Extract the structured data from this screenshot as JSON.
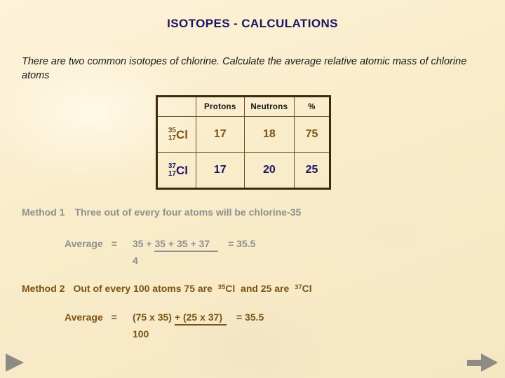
{
  "slide": {
    "title": "ISOTOPES - CALCULATIONS",
    "intro": "There are two common isotopes of chlorine. Calculate the average relative atomic mass of chlorine atoms",
    "background_color": "#faeed0",
    "title_color": "#1b1464"
  },
  "table": {
    "headers": {
      "corner": "",
      "protons": "Protons",
      "neutrons": "Neutrons",
      "percent": "%"
    },
    "rows": [
      {
        "nuclide": {
          "mass_number": "35",
          "atomic_number": "17",
          "symbol": "Cl"
        },
        "protons": "17",
        "neutrons": "18",
        "percent": "75",
        "color": "#7a5314"
      },
      {
        "nuclide": {
          "mass_number": "37",
          "atomic_number": "17",
          "symbol": "Cl"
        },
        "protons": "17",
        "neutrons": "20",
        "percent": "25",
        "color": "#1b1464"
      }
    ]
  },
  "method1": {
    "label": "Method 1",
    "statement": "Three out of every four atoms will be chlorine-35",
    "color": "#8f8f8f",
    "equation": {
      "label": "Average",
      "equals": "=",
      "numerator_lead": "35 +",
      "numerator_rest": "35  +  35  +  37",
      "denominator": "4",
      "result": "=  35.5"
    }
  },
  "method2": {
    "label": "Method 2",
    "statement_part1": "Out of every 100 atoms  75  are",
    "superscript1": "35",
    "symbol1": "Cl",
    "statement_part2": "and   25  are",
    "superscript2": "37",
    "symbol2": "Cl",
    "color": "#7a5314",
    "equation": {
      "label": "Average",
      "equals": "=",
      "numerator_lead": "(75 x 35)",
      "numerator_rest": "+  (25 x 37)",
      "denominator": "100",
      "result": "=  35.5"
    }
  },
  "navigation": {
    "previous_icon": "triangle-right-icon",
    "next_icon": "arrow-right-icon",
    "color": "#8c8c84"
  }
}
